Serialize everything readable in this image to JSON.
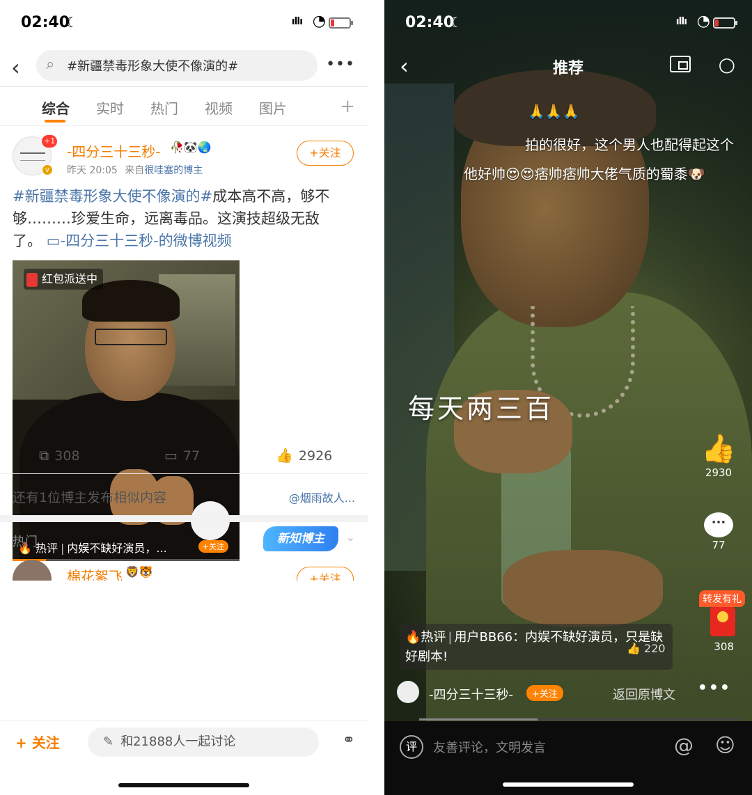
{
  "left": {
    "status": {
      "time": "02:40",
      "moon": "☾",
      "signal": "ıllı",
      "wifi": "◔"
    },
    "search": {
      "query": "#新疆禁毒形象大使不像演的#"
    },
    "tabs": [
      "综合",
      "实时",
      "热门",
      "视频",
      "图片"
    ],
    "post": {
      "badge": "+1",
      "author": "-四分三十三秒-",
      "author_icons": "🥀🐼🌏",
      "time": "昨天 20:05",
      "source_prefix": "来自",
      "source": "很哇塞的博主",
      "follow": "+关注",
      "tag": "#新疆禁毒形象大使不像演的#",
      "text": "成本高不高，够不够………珍爱生命，远离毒品。这演技超级无敌了。",
      "video_link": "-四分三十三秒-的微博视频",
      "video_badge": "红包派送中",
      "hot_label": "热评",
      "hot_comment": "内娱不缺好演员，...",
      "mini_follow": "+关注",
      "reposts": "308",
      "comments": "77",
      "likes": "2926"
    },
    "similar": {
      "text": "还有1位博主发布相似内容",
      "right": "@烟雨故人..."
    },
    "hot_section": {
      "title": "热门",
      "promo": "新知博主"
    },
    "next_post": {
      "author": "棉花絮飞",
      "icons": "🦁🐯",
      "follow": "+关注"
    },
    "bottom": {
      "follow": "+ 关注",
      "discuss": "和21888人一起讨论"
    }
  },
  "right": {
    "status": {
      "time": "02:40",
      "moon": "☾",
      "signal": "ıllı",
      "wifi": "◔"
    },
    "title": "推荐",
    "danmu": [
      "🙏🙏🙏",
      "拍的很好，这个男人也配得起这个",
      "他好帅😍😍痞帅痞帅大佬气质的蜀黍🐶"
    ],
    "subtitle": "每天两三百",
    "likes": "2930",
    "comments": "77",
    "gift_label": "转发有礼",
    "gift_count": "308",
    "hot_comment": {
      "label": "热评",
      "text": "用户BB66：内娱不缺好演员，只是缺好剧本!",
      "likes": "220"
    },
    "author": "-四分三十三秒-",
    "follow": "+关注",
    "back_original": "返回原博文",
    "comment_placeholder": "友善评论，文明发言",
    "comment_icon": "评"
  },
  "colors": {
    "brand_orange": "#ff8200",
    "link_blue": "#4a75a9"
  },
  "video_progress": 0.37
}
